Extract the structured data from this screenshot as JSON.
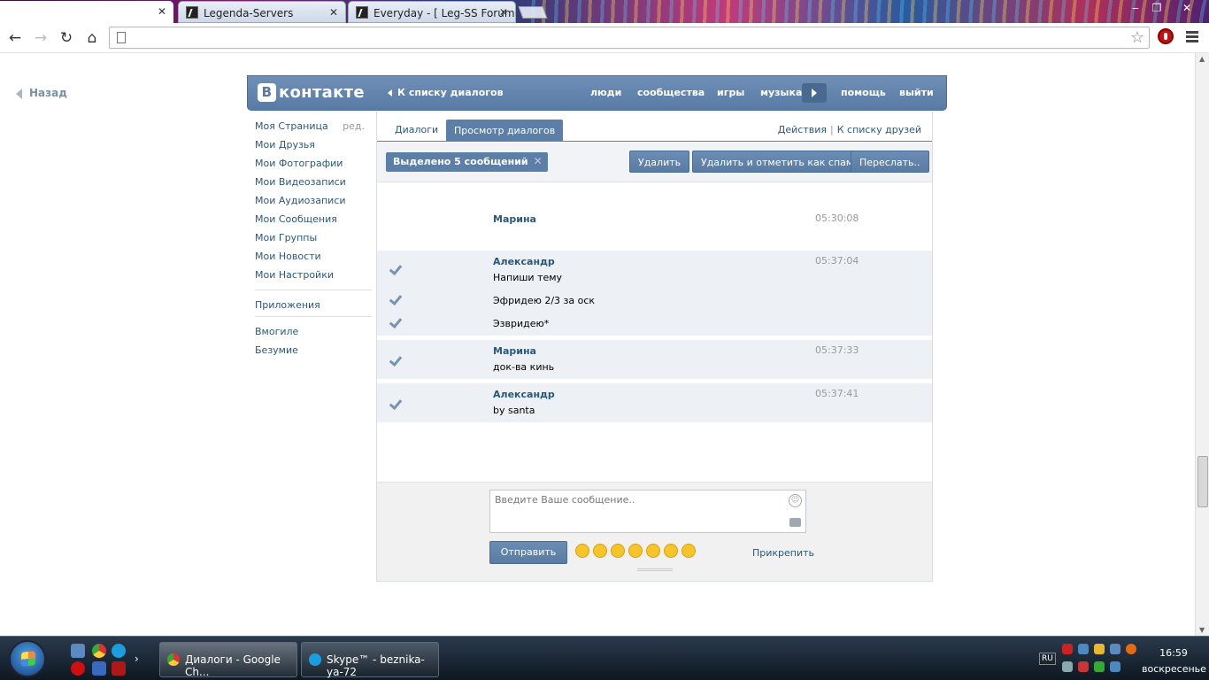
{
  "browser": {
    "tabs": [
      {
        "label": "",
        "active": true
      },
      {
        "label": "Legenda-Servers",
        "active": false
      },
      {
        "label": "Everyday - [ Leg-SS Forum ]",
        "active": false
      }
    ],
    "address": "",
    "window_buttons": {
      "minimize": "‒",
      "restore": "❐",
      "close": "✕"
    }
  },
  "page": {
    "back_label": "Назад",
    "header": {
      "logo": "контакте",
      "logo_letter": "В",
      "to_dialogs": "К списку диалогов",
      "nav": [
        "люди",
        "сообщества",
        "игры",
        "музыка",
        "помощь",
        "выйти"
      ]
    },
    "sidebar": {
      "items": [
        "Моя Страница",
        "Мои Друзья",
        "Мои Фотографии",
        "Мои Видеозаписи",
        "Мои Аудиозаписи",
        "Мои Сообщения",
        "Мои Группы",
        "Мои Новости",
        "Мои Настройки"
      ],
      "edit": "ред.",
      "apps": "Приложения",
      "extra": [
        "Вмогиле",
        "Безумие"
      ]
    },
    "tabs": {
      "dialogs": "Диалоги",
      "view": "Просмотр диалогов"
    },
    "actions": {
      "actions": "Действия",
      "separator": "|",
      "friends": "К списку друзей"
    },
    "selection": {
      "badge": "Выделено 5 сообщений",
      "delete": "Удалить",
      "spam": "Удалить и отметить как спам",
      "forward": "Переслать.."
    },
    "messages": [
      {
        "author": "Марина",
        "time": "05:30:08",
        "lines": []
      },
      {
        "author": "Александр",
        "time": "05:37:04",
        "lines": [
          "Напиши тему",
          "Эфридею 2/3 за оск",
          "Эзвридею*"
        ]
      },
      {
        "author": "Марина",
        "time": "05:37:33",
        "lines": [
          "док-ва кинь"
        ]
      },
      {
        "author": "Александр",
        "time": "05:37:41",
        "lines": [
          "by santa"
        ]
      }
    ],
    "composer": {
      "placeholder": "Введите Ваше сообщение..",
      "send": "Отправить",
      "attach": "Прикрепить",
      "emoji_count": 7
    }
  },
  "taskbar": {
    "tasks": [
      "Диалоги - Google Ch...",
      "Skype™ - beznika-ya-72"
    ],
    "lang": "RU",
    "time": "16:59",
    "day": "воскресенье"
  },
  "colors": {
    "vk_blue": "#587ba5",
    "link": "#2b587a"
  }
}
